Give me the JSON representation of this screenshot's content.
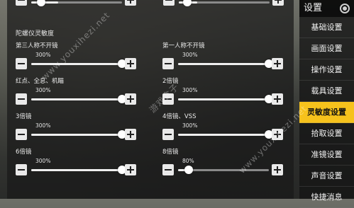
{
  "sidebar": {
    "title": "设置",
    "items": [
      {
        "label": "基础设置",
        "active": false
      },
      {
        "label": "画面设置",
        "active": false
      },
      {
        "label": "操作设置",
        "active": false
      },
      {
        "label": "载具设置",
        "active": false
      },
      {
        "label": "灵敏度设置",
        "active": true
      },
      {
        "label": "拾取设置",
        "active": false
      },
      {
        "label": "准镜设置",
        "active": false
      },
      {
        "label": "声音设置",
        "active": false
      },
      {
        "label": "快捷消息",
        "active": false
      }
    ]
  },
  "section": {
    "title": "陀螺仪灵敏度"
  },
  "settings": [
    {
      "label": "第三人称不开镜",
      "value": "300%",
      "level_percent": 100
    },
    {
      "label": "第一人称不开镜",
      "value": "300%",
      "level_percent": 100
    },
    {
      "label": "红点、全息、机瞄",
      "value": "300%",
      "level_percent": 100
    },
    {
      "label": "2倍镜",
      "value": "300%",
      "level_percent": 100
    },
    {
      "label": "3倍镜",
      "value": "300%",
      "level_percent": 100
    },
    {
      "label": "4倍镜、VSS",
      "value": "300%",
      "level_percent": 100
    },
    {
      "label": "6倍镜",
      "value": "300%",
      "level_percent": 100
    },
    {
      "label": "8倍镜",
      "value": "80%",
      "level_percent": 12
    }
  ],
  "watermarks": [
    "www.youxihezi.net",
    "游戏盒子"
  ],
  "colors": {
    "accent": "#f6c21c"
  }
}
